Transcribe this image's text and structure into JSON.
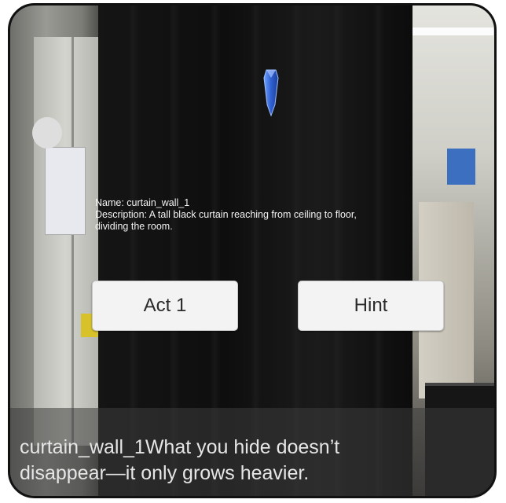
{
  "marker": {
    "icon": "crystal-marker-icon",
    "color": "#3f6fd8"
  },
  "info_panel": {
    "name_line": "Name: curtain_wall_1",
    "description_line1": "Description: A tall black curtain reaching from ceiling to floor,",
    "description_line2": "dividing the room."
  },
  "buttons": {
    "act_label": "Act 1",
    "hint_label": "Hint"
  },
  "subtitle": {
    "line1": "curtain_wall_1What you hide doesn’t",
    "line2": "disappear—it only grows heavier."
  }
}
